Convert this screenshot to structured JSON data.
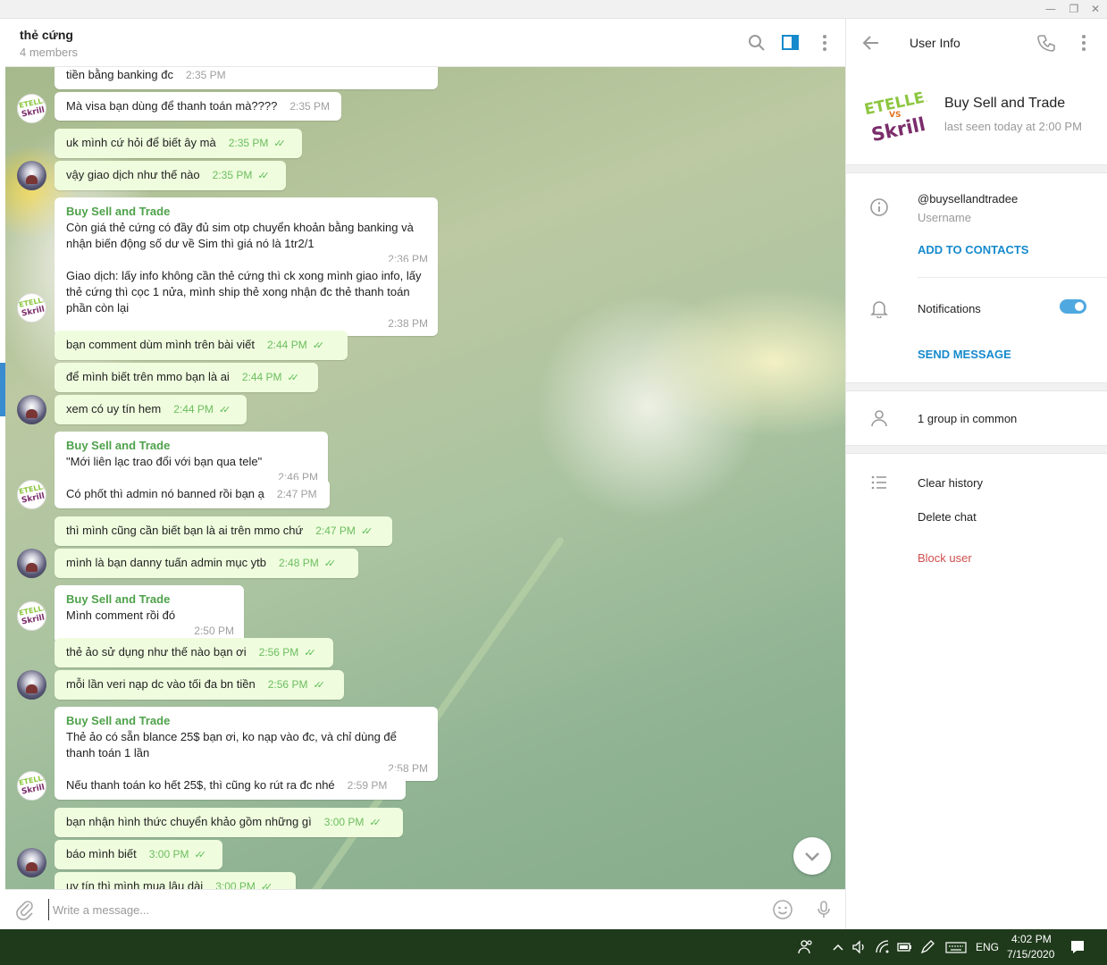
{
  "window": {
    "minimize_icon": "minimize-icon",
    "restore_icon": "restore-icon",
    "close_icon": "close-icon",
    "min_glyph": "—",
    "restore_glyph": "❐",
    "close_glyph": "✕"
  },
  "chat_header": {
    "title": "thẻ cứng",
    "subtitle": "4 members",
    "icons": [
      "search-icon",
      "sidebar-toggle-icon",
      "more-vertical-icon"
    ]
  },
  "messages": [
    {
      "dir": "in",
      "sender": "",
      "text": "tiền bằng banking đc",
      "time": "2:35 PM"
    },
    {
      "dir": "in",
      "sender": "",
      "text": "Mà visa bạn dùng để thanh toán mà????",
      "time": "2:35 PM"
    },
    {
      "dir": "out",
      "sender": "",
      "text": "uk mình cứ hỏi để biết ây mà",
      "time": "2:35 PM"
    },
    {
      "dir": "out",
      "sender": "",
      "text": "vậy giao dịch như thế nào",
      "time": "2:35 PM"
    },
    {
      "dir": "in",
      "sender": "Buy Sell and Trade",
      "text": "Còn giá thẻ cứng có đầy đủ sim otp chuyển khoản bằng banking và nhận biến động số dư về Sim thì giá nó là 1tr2/1",
      "time": "2:36 PM"
    },
    {
      "dir": "in",
      "sender": "",
      "text": "Giao dịch: lấy info không cần thẻ cứng thì ck xong mình giao info, lấy thẻ cứng thì cọc 1 nửa, mình ship thẻ xong nhận đc thẻ thanh toán phần còn lại",
      "time": "2:38 PM"
    },
    {
      "dir": "out",
      "sender": "",
      "text": "bạn comment dùm mình trên bài viết",
      "time": "2:44 PM"
    },
    {
      "dir": "out",
      "sender": "",
      "text": "để mình biết trên mmo bạn là ai",
      "time": "2:44 PM"
    },
    {
      "dir": "out",
      "sender": "",
      "text": "xem có uy tín hem",
      "time": "2:44 PM"
    },
    {
      "dir": "in",
      "sender": "Buy Sell and Trade",
      "text": "\"Mới liên lạc trao đổi với bạn qua tele\"",
      "time": "2:46 PM"
    },
    {
      "dir": "in",
      "sender": "",
      "text": "Có phốt thì admin nó banned rồi bạn ạ",
      "time": "2:47 PM"
    },
    {
      "dir": "out",
      "sender": "",
      "text": "thì mình cũng cần biết bạn là ai trên mmo chứ",
      "time": "2:47 PM"
    },
    {
      "dir": "out",
      "sender": "",
      "text": "mình là bạn danny tuấn admin mục ytb",
      "time": "2:48 PM"
    },
    {
      "dir": "in",
      "sender": "Buy Sell and Trade",
      "text": "Mình comment rồi đó",
      "time": "2:50 PM"
    },
    {
      "dir": "out",
      "sender": "",
      "text": "thẻ ảo sử dụng như thế nào bạn ơi",
      "time": "2:56 PM"
    },
    {
      "dir": "out",
      "sender": "",
      "text": "mỗi lần veri nạp dc vào tối đa bn tiền",
      "time": "2:56 PM"
    },
    {
      "dir": "in",
      "sender": "Buy Sell and Trade",
      "text": "Thẻ ảo có sẵn blance 25$ bạn ơi, ko nạp vào đc, và chỉ dùng để thanh toán 1 lần",
      "time": "2:58 PM"
    },
    {
      "dir": "in",
      "sender": "",
      "text": "Nếu thanh toán ko hết 25$, thì cũng ko rút ra đc nhé",
      "time": "2:59 PM"
    },
    {
      "dir": "out",
      "sender": "",
      "text": "bạn nhận hình thức chuyển khảo gồm những gì",
      "time": "3:00 PM"
    },
    {
      "dir": "out",
      "sender": "",
      "text": "báo mình biết",
      "time": "3:00 PM"
    },
    {
      "dir": "out",
      "sender": "",
      "text": "uy tín thì mình mua lâu dài",
      "time": "3:00 PM"
    }
  ],
  "avatars": {
    "bst_l1": "ETELLER",
    "bst_vs": "VS",
    "bst_l2": "Skrill"
  },
  "composer": {
    "placeholder": "Write a message...",
    "icons": [
      "attach-icon",
      "emoji-icon",
      "microphone-icon"
    ]
  },
  "user_info": {
    "title": "User Info",
    "name": "Buy Sell and Trade",
    "last_seen": "last seen today at 2:00 PM",
    "username": "@buysellandtradee",
    "username_label": "Username",
    "add_to_contacts": "ADD TO CONTACTS",
    "notifications_label": "Notifications",
    "notifications_on": true,
    "send_message": "SEND MESSAGE",
    "groups_in_common": "1 group in common",
    "clear_history": "Clear history",
    "delete_chat": "Delete chat",
    "block_user": "Block user"
  },
  "taskbar": {
    "language": "ENG",
    "time": "4:02 PM",
    "date": "7/15/2020"
  },
  "colors": {
    "accent": "#168acd",
    "sender_green": "#4ea14a",
    "out_bubble": "#effdde",
    "danger": "#d14e4e",
    "taskbar": "#1f3a1b"
  }
}
